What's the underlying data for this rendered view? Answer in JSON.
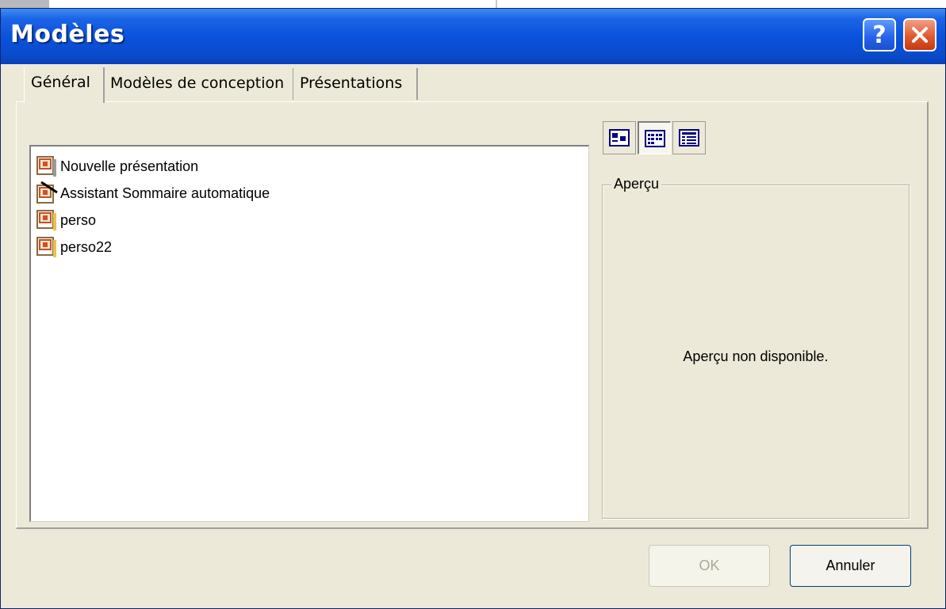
{
  "window": {
    "title": "Modèles",
    "help_glyph": "?"
  },
  "tabs": [
    {
      "label": "Général",
      "active": true
    },
    {
      "label": "Modèles de conception",
      "active": false
    },
    {
      "label": "Présentations",
      "active": false
    }
  ],
  "list": {
    "items": [
      {
        "label": "Nouvelle présentation",
        "icon": "presentation-icon"
      },
      {
        "label": "Assistant Sommaire automatique",
        "icon": "wizard-icon"
      },
      {
        "label": "perso",
        "icon": "presentation-icon"
      },
      {
        "label": "perso22",
        "icon": "presentation-icon"
      }
    ]
  },
  "view_buttons": [
    {
      "name": "large-icons-view",
      "pressed": false
    },
    {
      "name": "list-view",
      "pressed": true
    },
    {
      "name": "details-view",
      "pressed": false
    }
  ],
  "preview": {
    "legend": "Aperçu",
    "message": "Aperçu non disponible."
  },
  "buttons": {
    "ok": "OK",
    "cancel": "Annuler"
  },
  "colors": {
    "titlebar": "#0a52dc",
    "dialog_bg": "#ece9d8",
    "close": "#e05a30"
  }
}
